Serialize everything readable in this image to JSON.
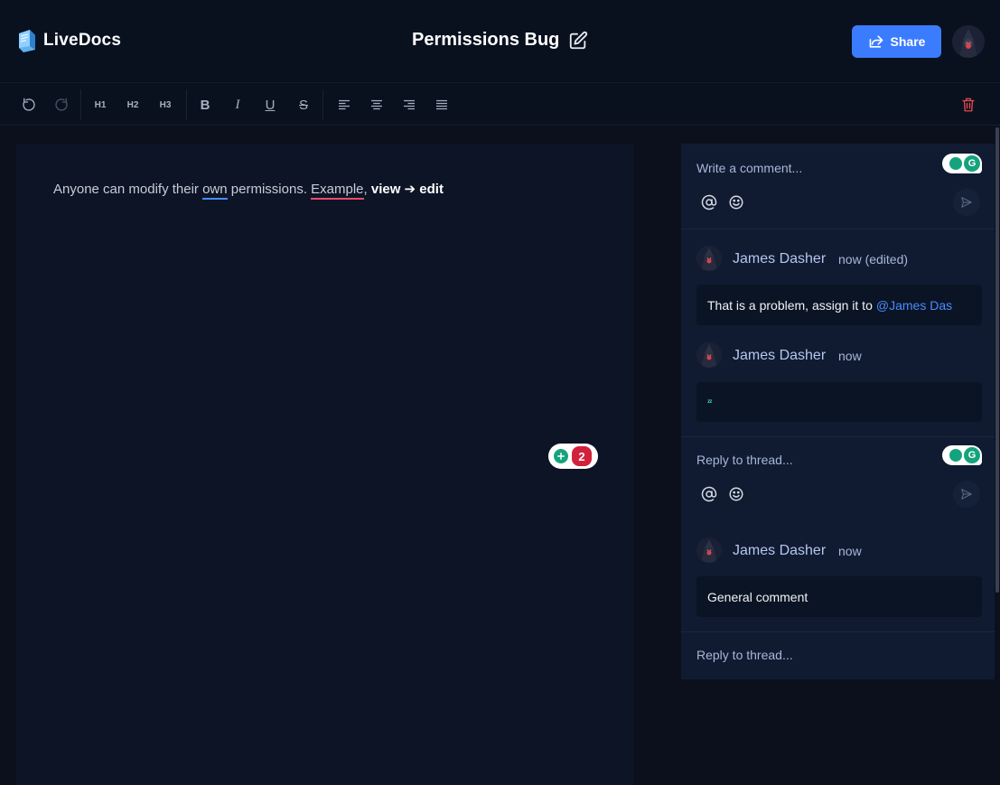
{
  "app": {
    "name": "LiveDocs"
  },
  "document": {
    "title": "Permissions Bug",
    "text_plain_1": "Anyone can modify their ",
    "text_underlined_blue": "own",
    "text_plain_2": " permissions. ",
    "text_underlined_red": "Example",
    "text_plain_3": ", ",
    "text_bold": "view ➔ edit",
    "grammarly_issue_count": "2"
  },
  "header": {
    "share_label": "Share"
  },
  "toolbar": {
    "undo": "undo-icon",
    "redo": "redo-icon",
    "h1": "H1",
    "h2": "H2",
    "h3": "H3",
    "bold": "B",
    "italic": "I",
    "underline": "U",
    "strike": "S"
  },
  "comments": {
    "new_comment_placeholder": "Write a comment...",
    "threads": [
      {
        "comments": [
          {
            "author": "James Dasher",
            "time": "now (edited)",
            "body": "That is a problem, assign it to",
            "mention": "@James Das"
          },
          {
            "author": "James Dasher",
            "time": "now",
            "body": "ᶻᶻ"
          }
        ],
        "reply_placeholder": "Reply to thread..."
      },
      {
        "comments": [
          {
            "author": "James Dasher",
            "time": "now",
            "body": "General comment"
          }
        ],
        "reply_placeholder": "Reply to thread..."
      }
    ]
  },
  "colors": {
    "accent": "#3b7cff",
    "background": "#0b101c",
    "editor_bg": "#0c1426",
    "panel_bg": "#101b31",
    "danger": "#e5484d"
  }
}
